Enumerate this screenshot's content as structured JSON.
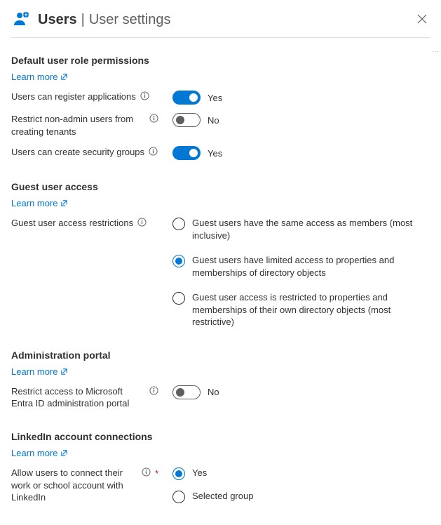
{
  "header": {
    "title": "Users",
    "subtitle": "User settings"
  },
  "sections": {
    "default_role": {
      "heading": "Default user role permissions",
      "learn_more": "Learn more",
      "rows": {
        "register_apps": {
          "label": "Users can register applications",
          "state": "Yes"
        },
        "restrict_tenants": {
          "label": "Restrict non-admin users from creating tenants",
          "state": "No"
        },
        "security_groups": {
          "label": "Users can create security groups",
          "state": "Yes"
        }
      }
    },
    "guest_access": {
      "heading": "Guest user access",
      "learn_more": "Learn more",
      "row_label": "Guest user access restrictions",
      "options": [
        "Guest users have the same access as members (most inclusive)",
        "Guest users have limited access to properties and memberships of directory objects",
        "Guest user access is restricted to properties and memberships of their own directory objects (most restrictive)"
      ]
    },
    "admin_portal": {
      "heading": "Administration portal",
      "learn_more": "Learn more",
      "row": {
        "label": "Restrict access to Microsoft Entra ID administration portal",
        "state": "No"
      }
    },
    "linkedin": {
      "heading": "LinkedIn account connections",
      "learn_more": "Learn more",
      "row_label": "Allow users to connect their work or school account with LinkedIn",
      "options": [
        "Yes",
        "Selected group"
      ]
    }
  }
}
